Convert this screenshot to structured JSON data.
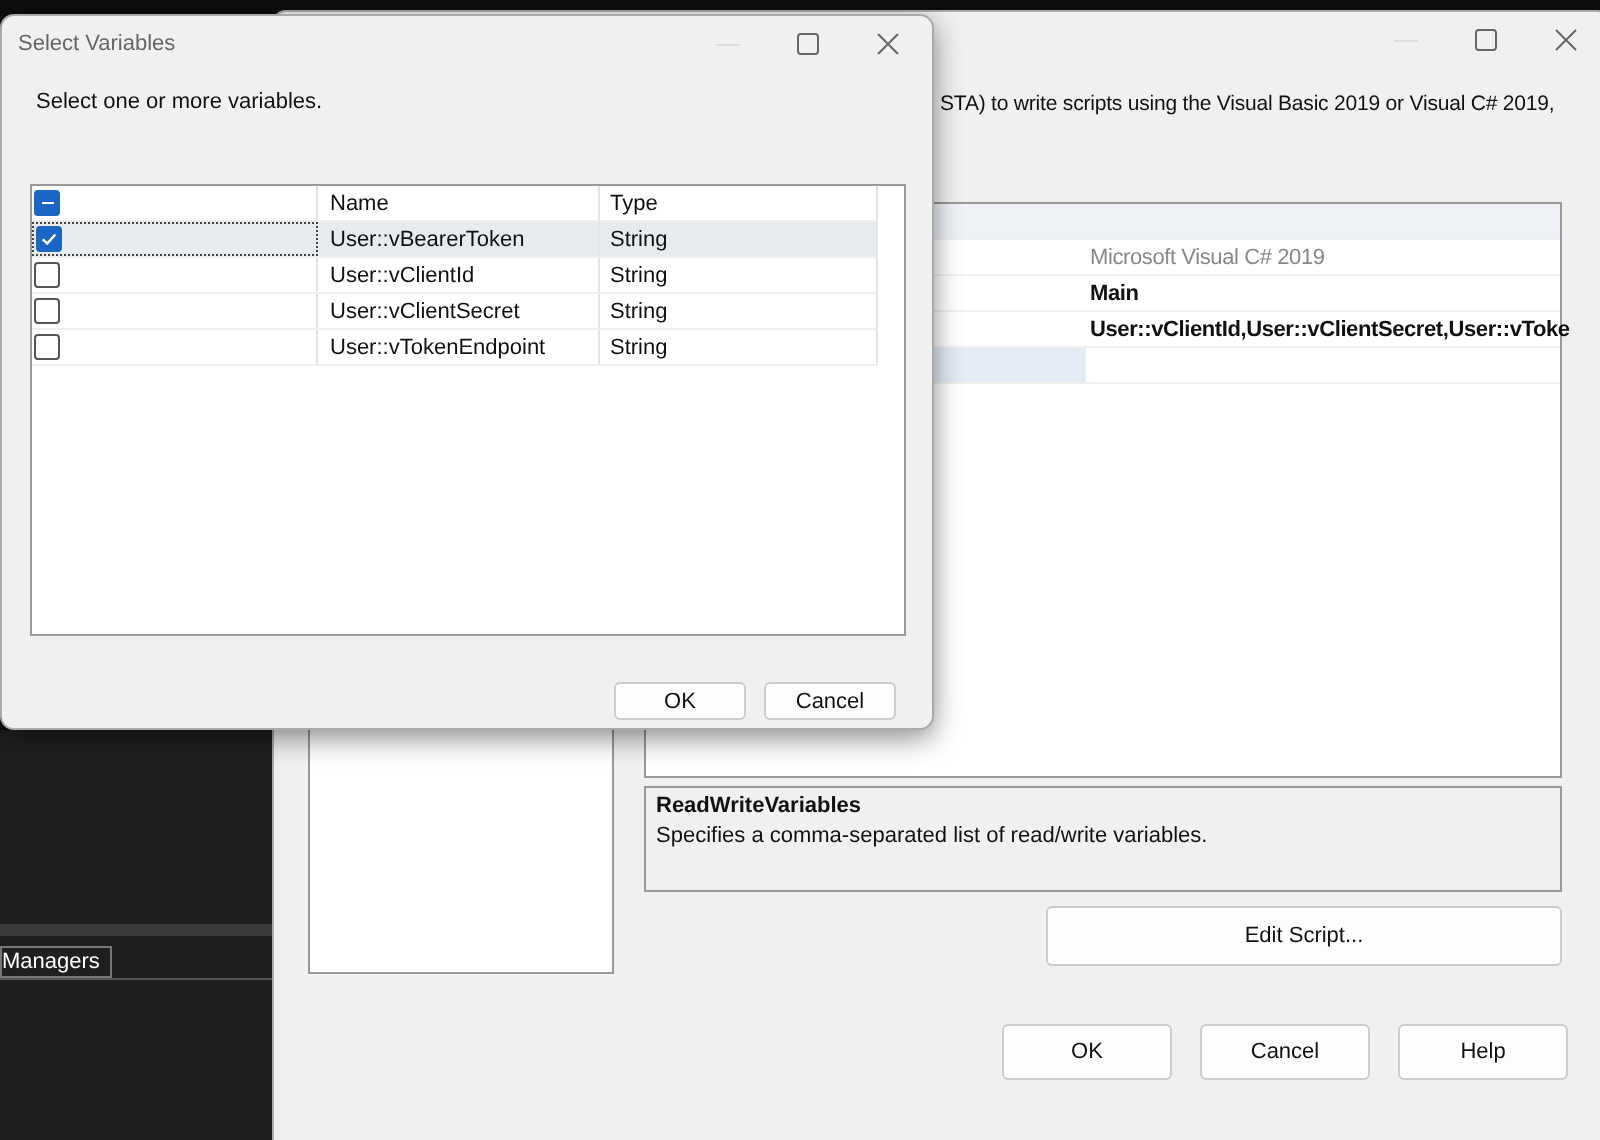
{
  "background_panel": {
    "tab": "Managers"
  },
  "script_task_editor": {
    "description": "STA) to write scripts using the Visual Basic 2019 or Visual C# 2019,",
    "properties": [
      {
        "kind": "header"
      },
      {
        "kind": "readonly",
        "value": "Microsoft Visual C# 2019",
        "selected": false
      },
      {
        "kind": "set",
        "value": "Main",
        "selected": false
      },
      {
        "kind": "set",
        "value": "User::vClientId,User::vClientSecret,User::vToke",
        "selected": false
      },
      {
        "kind": "empty",
        "selected": true
      }
    ],
    "property_help": {
      "title": "ReadWriteVariables",
      "text": "Specifies a comma-separated list of read/write variables."
    },
    "edit_button": "Edit Script...",
    "buttons": [
      "OK",
      "Cancel",
      "Help"
    ]
  },
  "select_variables": {
    "title": "Select Variables",
    "instruction": "Select one or more variables.",
    "header_indeterminate": true,
    "columns": [
      "Name",
      "Type"
    ],
    "rows": [
      {
        "checked": true,
        "selected": true,
        "name": "User::vBearerToken",
        "type": "String"
      },
      {
        "checked": false,
        "selected": false,
        "name": "User::vClientId",
        "type": "String"
      },
      {
        "checked": false,
        "selected": false,
        "name": "User::vClientSecret",
        "type": "String"
      },
      {
        "checked": false,
        "selected": false,
        "name": "User::vTokenEndpoint",
        "type": "String"
      }
    ],
    "buttons": [
      "OK",
      "Cancel"
    ]
  }
}
